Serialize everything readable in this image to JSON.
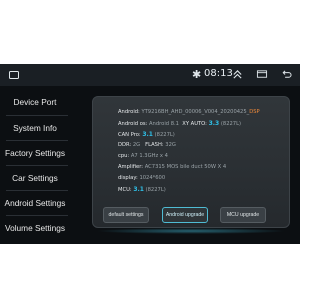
{
  "status_bar": {
    "time": "08:13"
  },
  "sidebar": {
    "items": [
      {
        "label": "Device Port"
      },
      {
        "label": "System Info"
      },
      {
        "label": "Factory Settings"
      },
      {
        "label": "Car Settings"
      },
      {
        "label": "Android Settings"
      },
      {
        "label": "Volume Settings"
      }
    ]
  },
  "info": {
    "android_label": "Android:",
    "android_value": "YT9216BH_AHD_00006_V004_20200425_",
    "android_suffix": "DSP",
    "android_os_label": "Android os:",
    "android_os_value": "Android 8.1",
    "xy_auto_label": "XY AUTO:",
    "xy_auto_version": "3.3",
    "xy_auto_build": "(8227L)",
    "can_pro_label": "CAN Pro:",
    "can_pro_version": "3.1",
    "can_pro_build": "(8227L)",
    "ddr_label": "DDR:",
    "ddr_value": "2G",
    "flash_label": "FLASH:",
    "flash_value": "32G",
    "cpu_label": "cpu:",
    "cpu_value": "A7 1.3GHz x 4",
    "amplifier_label": "Amplifier:",
    "amplifier_value": "AC7315 MOS bile duct 50W X 4",
    "display_label": "display:",
    "display_value": "1024*600",
    "mcu_label": "MCU:",
    "mcu_version": "3.1",
    "mcu_build": "(8227L)"
  },
  "buttons": {
    "default_settings": "default settings",
    "android_upgrade": "Android upgrade",
    "mcu_upgrade": "MCU upgrade"
  },
  "colors": {
    "accent": "#2ec0e8",
    "highlight": "#f08a3a",
    "background": "#0c0f12"
  }
}
